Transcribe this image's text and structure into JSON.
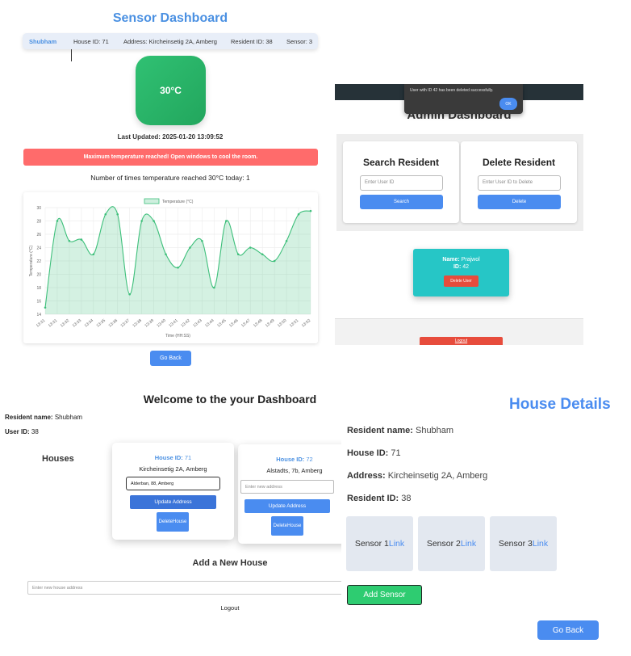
{
  "sensor_dashboard": {
    "title": "Sensor Dashboard",
    "user": "Shubham",
    "house_id": "House ID: 71",
    "address": "Address: Kircheinsetig 2A, Amberg",
    "resident_id": "Resident ID: 38",
    "sensor": "Sensor: 3",
    "temperature": "30°C",
    "last_updated": "Last Updated: 2025-01-20 13:09:52",
    "alert": "Maximum temperature reached! Open windows to cool the room.",
    "count_text": "Number of times temperature reached 30°C today: 1",
    "go_back": "Go Back",
    "colors": {
      "accent": "#4a90e2",
      "temp_box": "#2dbb6d",
      "alert": "#ff6b6b",
      "line": "#3dbf7a"
    }
  },
  "chart_data": {
    "type": "line",
    "legend": "Temperature (°C)",
    "legend_position": "top",
    "xlabel": "Time (HH:SS)",
    "ylabel": "Temperature (°C)",
    "ylim": [
      14,
      30
    ],
    "yticks": [
      "30",
      "28",
      "26",
      "24",
      "22",
      "20",
      "18",
      "16",
      "14"
    ],
    "grid": true,
    "x": [
      "13:31",
      "13:31",
      "13:32",
      "13:33",
      "13:34",
      "13:35",
      "13:36",
      "13:37",
      "13:38",
      "13:39",
      "13:40",
      "13:41",
      "13:42",
      "13:43",
      "13:44",
      "13:45",
      "13:46",
      "13:47",
      "13:48",
      "13:49",
      "13:50",
      "13:51",
      "13:52"
    ],
    "series": [
      {
        "name": "Temperature (°C)",
        "values": [
          15,
          28,
          25,
          25.2,
          23,
          29,
          29,
          17,
          28,
          28,
          23,
          21,
          24,
          25,
          18,
          28,
          23,
          24,
          23,
          22,
          25,
          29,
          29.5
        ]
      }
    ]
  },
  "admin": {
    "title": "Admin Dashboard",
    "toast_message": "User with ID 42 has been deleted successfully.",
    "toast_ok": "OK",
    "search_title": "Search Resident",
    "search_placeholder": "Enter User ID",
    "search_button": "Search",
    "delete_title": "Delete Resident",
    "delete_placeholder": "Enter User ID to Delete",
    "delete_button": "Delete",
    "result_name_label": "Name:",
    "result_name": "Prajwol",
    "result_id_label": "ID:",
    "result_id": "42",
    "delete_user_button": "Delete User",
    "logout": "Logout"
  },
  "resident": {
    "title": "Welcome to the your Dashboard",
    "name_label": "Resident name:",
    "name": "Shubham",
    "user_id_label": "User ID:",
    "user_id": "38",
    "houses_label": "Houses",
    "houses": [
      {
        "id_label": "House ID:",
        "id": "71",
        "address": "Kircheinsetig 2A, Amberg",
        "input_value": "Alderban, 88, Amberg",
        "update": "Update Address",
        "delete_l1": "Delete",
        "delete_l2": "House"
      },
      {
        "id_label": "House ID:",
        "id": "72",
        "address": "Alstadts, 7b, Amberg",
        "input_placeholder": "Enter new address",
        "update": "Update Address",
        "delete_l1": "Delete",
        "delete_l2": "House"
      }
    ],
    "add_house_title": "Add a New House",
    "new_house_placeholder": "Enter new house address",
    "logout": "Logout"
  },
  "house_details": {
    "title": "House Details",
    "name_label": "Resident name:",
    "name": "Shubham",
    "house_id_label": "House ID:",
    "house_id": "71",
    "address_label": "Address:",
    "address": "Kircheinsetig 2A, Amberg",
    "resident_id_label": "Resident ID:",
    "resident_id": "38",
    "sensors": [
      {
        "label": "Sensor 1",
        "link": "Link"
      },
      {
        "label": "Sensor 2",
        "link": "Link"
      },
      {
        "label": "Sensor 3",
        "link": "Link"
      }
    ],
    "add_sensor": "Add Sensor",
    "go_back": "Go Back"
  }
}
